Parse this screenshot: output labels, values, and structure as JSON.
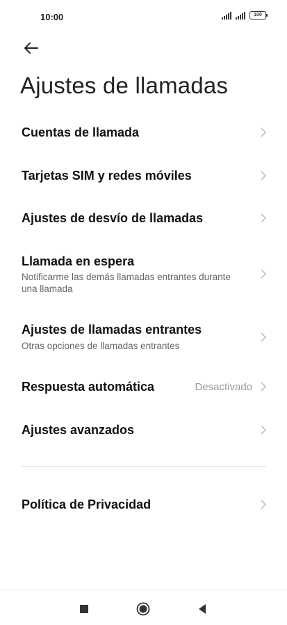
{
  "status": {
    "time": "10:00",
    "battery": "100"
  },
  "page": {
    "title": "Ajustes de llamadas"
  },
  "items": [
    {
      "label": "Cuentas de llamada"
    },
    {
      "label": "Tarjetas SIM y redes móviles"
    },
    {
      "label": "Ajustes de desvío de llamadas"
    },
    {
      "label": "Llamada en espera",
      "sub": "Notificarme las demás llamadas entrantes durante una llamada"
    },
    {
      "label": "Ajustes de llamadas entrantes",
      "sub": "Otras opciones de llamadas entrantes"
    },
    {
      "label": "Respuesta automática",
      "value": "Desactivado"
    },
    {
      "label": "Ajustes avanzados"
    },
    {
      "label": "Política de Privacidad"
    }
  ],
  "icons": {
    "back": "arrow-left-icon",
    "chevron": "chevron-right-icon",
    "nav": [
      "square-icon",
      "circle-icon",
      "triangle-back-icon"
    ]
  }
}
